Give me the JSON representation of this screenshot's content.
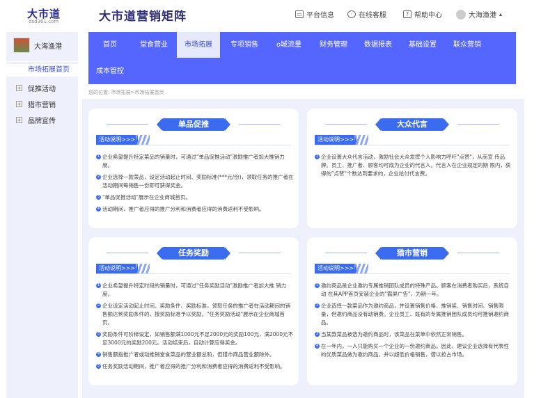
{
  "header": {
    "logo_title": "大市道",
    "logo_sub": "dsd361.com",
    "brand": "大市道营销矩阵",
    "links": [
      {
        "label": "平台信息",
        "icon": "monitor-icon"
      },
      {
        "label": "在线客服",
        "icon": "chat-icon"
      },
      {
        "label": "帮助中心",
        "icon": "help-icon"
      }
    ],
    "user": "大海渔港",
    "user_caret": "▴"
  },
  "sidebar": {
    "shop_name": "大海渔港",
    "active_item": "市场拓展首页",
    "items": [
      {
        "label": "促推活动",
        "expander": "+"
      },
      {
        "label": "猎市营销",
        "expander": "+"
      },
      {
        "label": "品牌宣传",
        "expander": "+"
      }
    ]
  },
  "nav": {
    "items": [
      "首页",
      "堂食营业",
      "市场拓展",
      "专项销售",
      "o城流量",
      "财务管理",
      "数据报表",
      "基础设置",
      "联众营销",
      "成本管控"
    ],
    "active_index": 2
  },
  "breadcrumb": "您的位置: 市场拓展>市场拓展首页",
  "tag_label": "活动说明>>>",
  "cards": [
    {
      "title": "单品促推",
      "items": [
        {
          "n": "1",
          "text": "企业希望提升特定菜品的销量时，可通过\"单品促推活动\"激励推广者加大推销力度。"
        },
        {
          "n": "2",
          "text": "企业选择一款菜品，设定活动起止时间、奖励标准(***元/份)，领取任务的推广者在活动期间每销售一份即可获得奖金。"
        },
        {
          "n": "3",
          "text": "\"单品促推活动\"展示在企业商城首页。"
        },
        {
          "n": "4",
          "text": "活动期间，推广者应得的推广分利和消费者应得的消费返利不受影响。"
        }
      ]
    },
    {
      "title": "大众代言",
      "items": [
        {
          "n": "1",
          "text": "企业设置大众代言活动，激励社会大众发挥个人影响力呼吁\"点赞\"，从而宣 传品牌。员工、推广者、顾客均可成为企业的代言人。代言人在企业规定的期 限内，获得的\"点赞\"个数达到要求的，企业给付代言费。"
        }
      ]
    },
    {
      "title": "任务奖励",
      "items": [
        {
          "n": "1",
          "text": "企业希望提升特定时段的销量时，可通过\"任务奖励活动\"激励推广者加大推 销力度。"
        },
        {
          "n": "2",
          "text": "企业设定活动起止时间、奖励条件、奖励标准，领取任务的推广者在活动期间的销售额达到奖励条件的，按奖励标准予以奖励。\"任务奖励活动\"展示在企业商城首页。"
        },
        {
          "n": "3",
          "text": "奖励条件可阶梯设定，如销售额满1000元不足2000元的奖励100元，满2000元不足3000元的奖励200元。活动结束后，自动计算应得奖金。"
        },
        {
          "n": "4",
          "text": "销售额指推广者或动推销堂食菜品的营业额总和，但猎市商品营业额除外。"
        },
        {
          "n": "5",
          "text": "任务奖励活动期间，推广者应得的推广分利和消费者应得的消费返利不受影响。"
        }
      ]
    },
    {
      "title": "猎市营销",
      "items": [
        {
          "n": "1",
          "text": "邀约商品是企业邀约专属推销团队成员的特殊产品。顾客在消费者购买后，系统自动 在其APP首页安装企业的\"霸屏广告\"，为期一年。"
        },
        {
          "n": "2",
          "text": "企业选择一款菜品作为邀约商品，并设置销售价格、推销奖、销售时间、销售限量，但邀约商品没有动销费。企业员工、既有的专属推销团队成员均可推销邀约商品。"
        },
        {
          "n": "3",
          "text": "当某款菜品被选为邀约商品时，该菜品在菜单中依然正常销售。"
        },
        {
          "n": "4",
          "text": "在一年内，一人只能购买一个企业的一份邀约商品。因此，建议企业选择有代表性的优质菜品做为邀约商品，并以超低价格销售，借以抢占市场。"
        }
      ]
    }
  ]
}
